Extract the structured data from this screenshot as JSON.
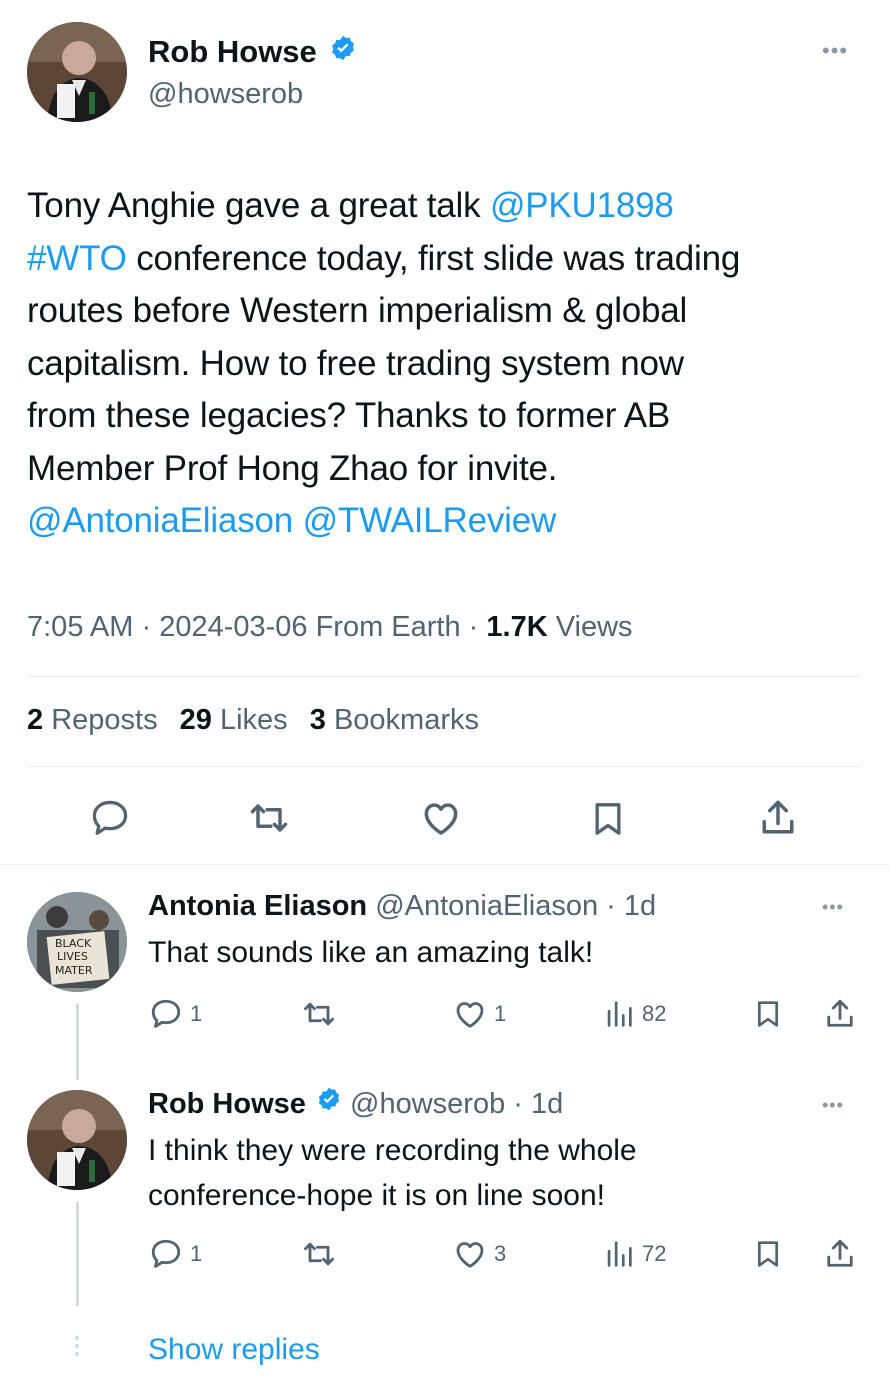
{
  "main_tweet": {
    "author_name": "Rob Howse",
    "author_handle": "@howserob",
    "text_parts": {
      "p1": "Tony Anghie  gave a great talk ",
      "mention1": "@PKU1898",
      "hashtag": "#WTO",
      "p2": " conference today, first slide was trading",
      "line3": "routes before Western imperialism & global",
      "line4": "capitalism. How to free trading system now",
      "line5": "from these legacies? Thanks to former AB",
      "line6": "Member Prof Hong Zhao for invite.",
      "mention2": "@AntoniaEliason",
      "mention3": "@TWAILReview"
    },
    "meta": {
      "time": "7:05 AM",
      "sep": " · ",
      "date": "2024-03-06",
      "source": " From Earth",
      "views_count": "1.7K",
      "views_label": " Views"
    },
    "stats": {
      "reposts_count": "2",
      "reposts_label": " Reposts",
      "likes_count": "29",
      "likes_label": " Likes",
      "bookmarks_count": "3",
      "bookmarks_label": " Bookmarks"
    },
    "menu_icon": "more-dots-icon"
  },
  "replies": [
    {
      "author_name": "Antonia Eliason",
      "author_handle": "@AntoniaEliason",
      "age": " · 1d",
      "text": "That sounds like an amazing talk!",
      "avatar_sign": [
        "BLACK",
        "LIVES",
        "MATER"
      ],
      "replies_count": "1",
      "likes_count": "1",
      "views_count": "82"
    },
    {
      "author_name": "Rob Howse",
      "author_handle": "@howserob",
      "age": " · 1d",
      "text_line1": "I think they were recording the whole",
      "text_line2": "conference-hope it is on line soon!",
      "replies_count": "1",
      "likes_count": "3",
      "views_count": "72"
    }
  ],
  "show_replies_label": "Show replies",
  "colors": {
    "accent": "#1d9bf0",
    "text": "#0f1419",
    "muted": "#536471",
    "divider": "#e6ecf0"
  }
}
